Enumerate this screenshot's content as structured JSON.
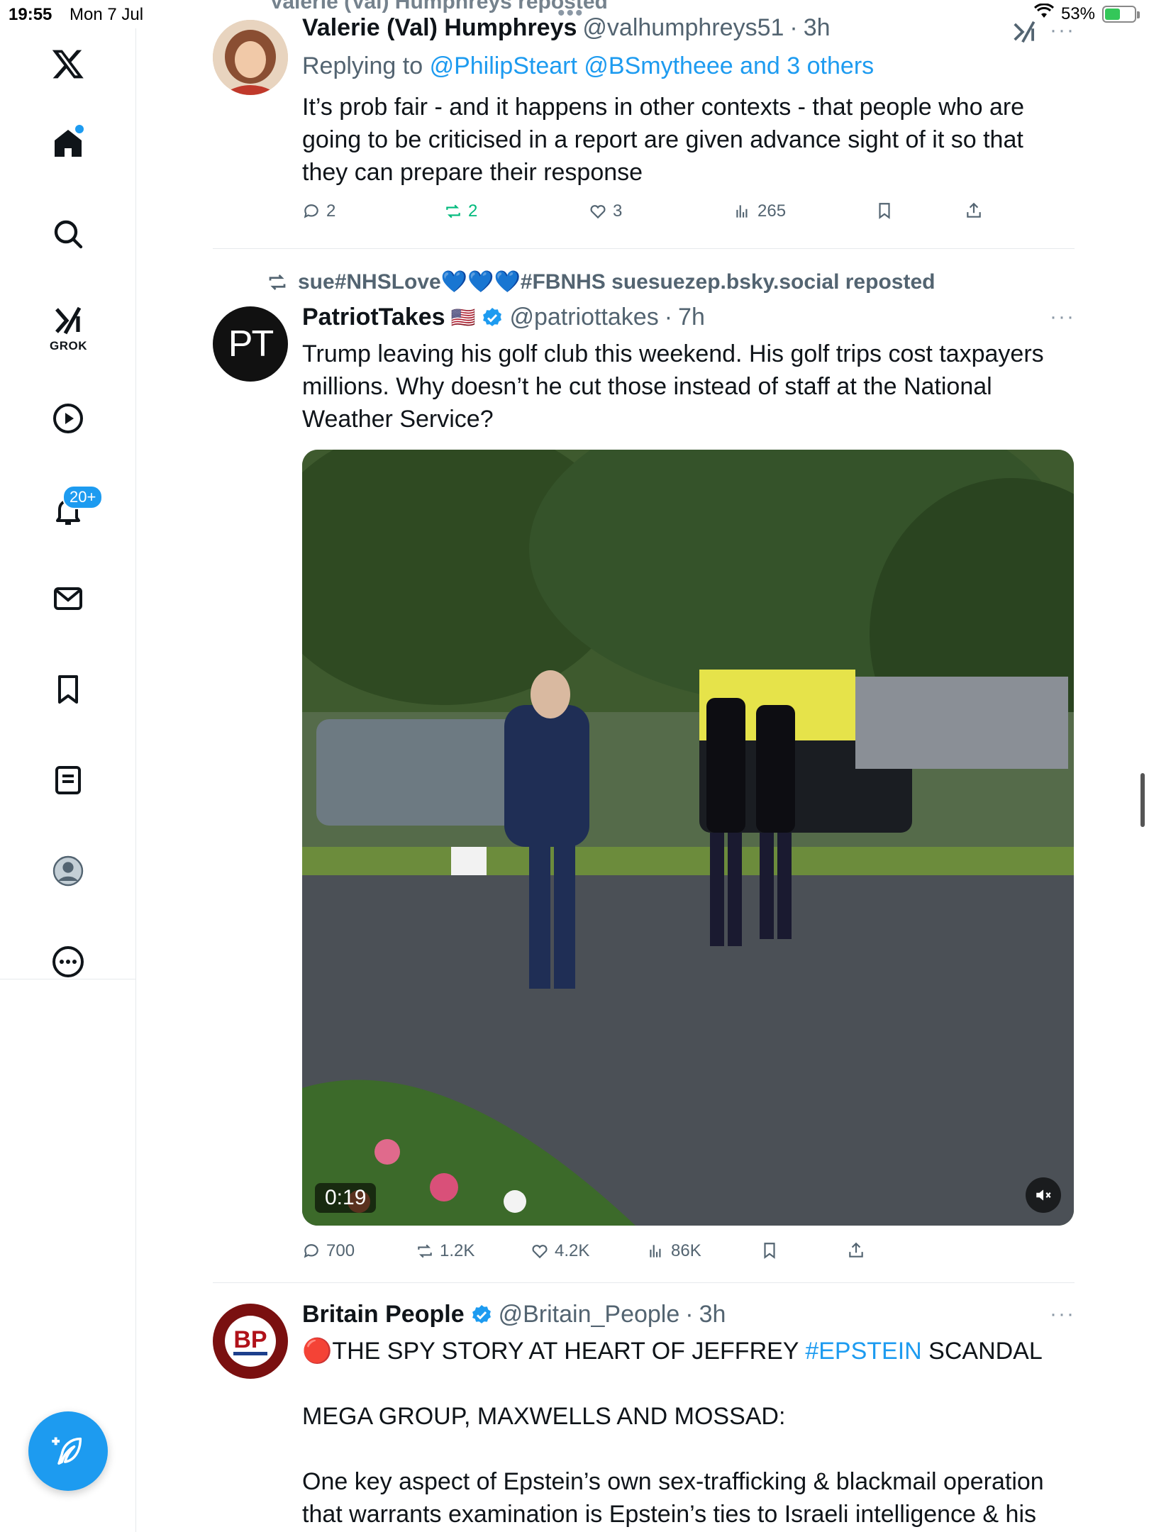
{
  "status_bar": {
    "time": "19:55",
    "date": "Mon 7 Jul",
    "battery": "53%"
  },
  "sidebar": {
    "items": [
      {
        "icon": "x-logo-icon",
        "label": "X"
      },
      {
        "icon": "home-icon",
        "label": "Home"
      },
      {
        "icon": "search-icon",
        "label": "Explore"
      },
      {
        "icon": "grok-icon",
        "label": "GROK"
      },
      {
        "icon": "video-icon",
        "label": "Video"
      },
      {
        "icon": "bell-icon",
        "label": "Notifications"
      },
      {
        "icon": "mail-icon",
        "label": "Messages"
      },
      {
        "icon": "bookmark-icon",
        "label": "Bookmarks"
      },
      {
        "icon": "list-icon",
        "label": "Lists"
      },
      {
        "icon": "profile-icon",
        "label": "Profile"
      },
      {
        "icon": "more-icon",
        "label": "More"
      }
    ],
    "grok_label": "GROK",
    "notifications_badge": "20+",
    "compose_icon": "compose-feather-icon"
  },
  "feed": {
    "top_cut_text": "Valerie (Val) Humphreys reposted",
    "tweets": [
      {
        "name": "Valerie (Val) Humphreys",
        "handle": "@valhumphreys51",
        "time": "3h",
        "replying_prefix": "Replying to",
        "replying_to": "@PhilipSteart @BSmytheee and 3 others",
        "text": "It’s prob fair - and it happens in other contexts - that people who are going to be criticised in a report are given advance sight of it so that they can prepare their response",
        "replies": "2",
        "reposts": "2",
        "likes": "3",
        "views": "265"
      },
      {
        "reposted_by": "sue#NHSLove💙💙💙#FBNHS suesuezep.bsky.social reposted",
        "name": "PatriotTakes",
        "flag": "🇺🇸",
        "handle": "@patriottakes",
        "time": "7h",
        "avatar_text": "PT",
        "text": "Trump leaving his golf club this weekend. His golf trips cost taxpayers millions. Why doesn’t he cut those instead of staff at the National Weather Service?",
        "video_duration": "0:19",
        "replies": "700",
        "reposts": "1.2K",
        "likes": "4.2K",
        "views": "86K"
      },
      {
        "name": "Britain People",
        "handle": "@Britain_People",
        "time": "3h",
        "avatar_text": "BP",
        "line1_prefix": "🔴THE SPY STORY AT HEART OF JEFFREY ",
        "line1_hashtag": "#EPSTEIN",
        "line1_suffix": " SCANDAL",
        "line2": "MEGA GROUP, MAXWELLS AND MOSSAD:",
        "line3": "One key aspect of Epstein’s own sex-trafficking & blackmail operation that warrants examination is Epstein’s ties to Israeli intelligence & his"
      }
    ]
  },
  "colors": {
    "accent": "#1d9bf0",
    "repost_green": "#00ba7c",
    "text_secondary": "#536471"
  }
}
